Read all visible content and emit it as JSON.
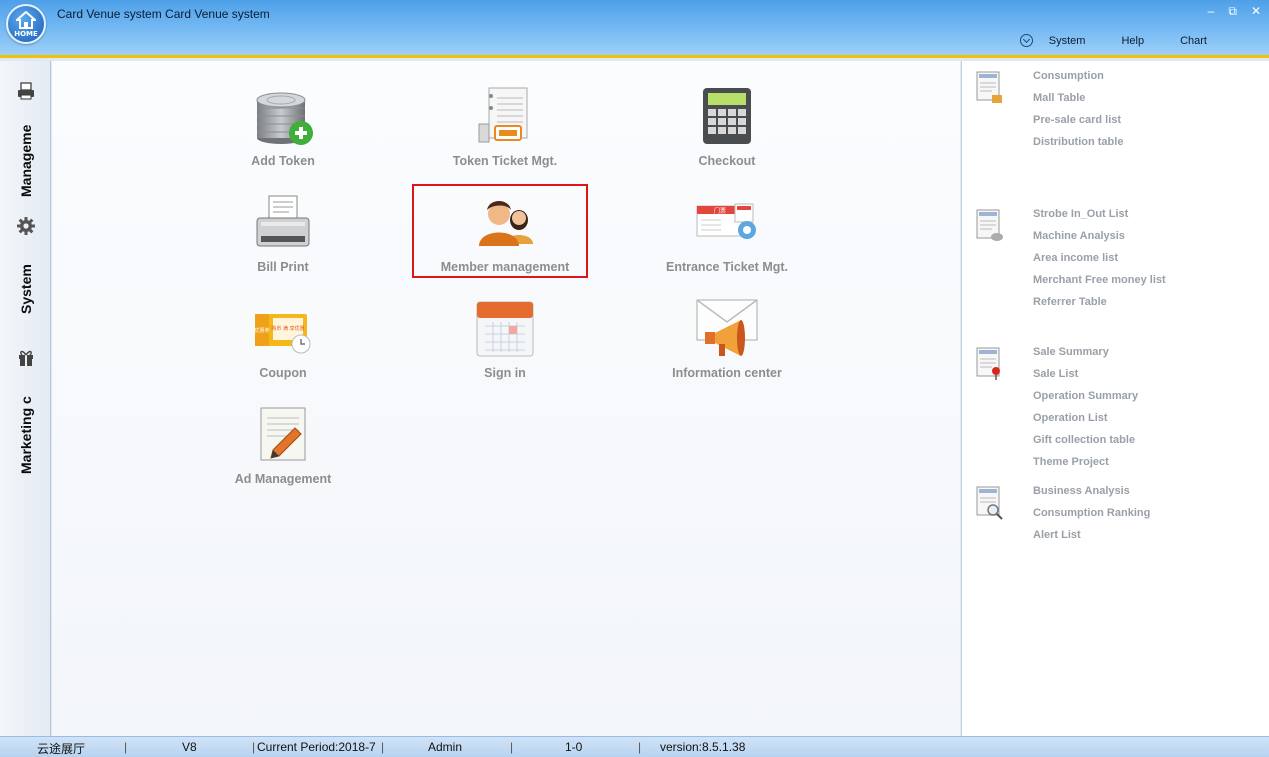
{
  "window": {
    "title": "Card Venue system Card Venue system",
    "home_logo_text": "HOME",
    "controls": {
      "minimize": "–",
      "restore": "⧉",
      "close": "✕"
    }
  },
  "menu": {
    "items": [
      "System",
      "Help",
      "Chart"
    ]
  },
  "sidebar": {
    "tabs": [
      {
        "label": "Manageme",
        "icon": "printer-icon"
      },
      {
        "label": "System",
        "icon": "gear-icon"
      },
      {
        "label": "Marketing c",
        "icon": "gift-icon"
      }
    ]
  },
  "tiles": [
    {
      "label": "Add Token",
      "icon": "coin-stack-add-icon"
    },
    {
      "label": "Token Ticket Mgt.",
      "icon": "ticket-notebook-icon"
    },
    {
      "label": "Checkout",
      "icon": "calculator-icon"
    },
    {
      "label": "Bill Print",
      "icon": "receipt-printer-icon"
    },
    {
      "label": "Member management",
      "icon": "members-icon"
    },
    {
      "label": "Entrance Ticket Mgt.",
      "icon": "entrance-ticket-icon"
    },
    {
      "label": "Coupon",
      "icon": "coupon-icon"
    },
    {
      "label": "Sign in",
      "icon": "calendar-icon"
    },
    {
      "label": "Information center",
      "icon": "megaphone-envelope-icon"
    },
    {
      "label": "Ad Management",
      "icon": "notepad-pencil-icon"
    }
  ],
  "tile_glyphs": {
    "entrance_ticket": "门票",
    "coupon_left": "优惠券",
    "coupon_main": "购币 满 享优惠"
  },
  "reports": [
    {
      "icon": "report-lock-icon",
      "items": [
        "Consumption",
        "Mall Table",
        "Pre-sale card list",
        "Distribution table"
      ]
    },
    {
      "icon": "report-coins-icon",
      "items": [
        "Strobe In_Out List",
        "Machine Analysis",
        "Area income list",
        "Merchant Free money list",
        "Referrer Table"
      ]
    },
    {
      "icon": "report-pin-icon",
      "items": [
        "Sale Summary",
        "Sale List",
        "Operation Summary",
        "Operation List",
        "Gift collection table",
        "Theme Project"
      ]
    },
    {
      "icon": "report-search-icon",
      "items": [
        "Business Analysis",
        "Consumption Ranking",
        "Alert List"
      ]
    }
  ],
  "status": {
    "venue": "云途展厅",
    "edition": "V8",
    "period": "Current Period:2018-7",
    "user": "Admin",
    "code": "1-0",
    "version": "version:8.5.1.38"
  },
  "colors": {
    "accent_bar": "#f2c200",
    "highlight_box": "#e0141b",
    "titlebar": "#4da0e8"
  }
}
